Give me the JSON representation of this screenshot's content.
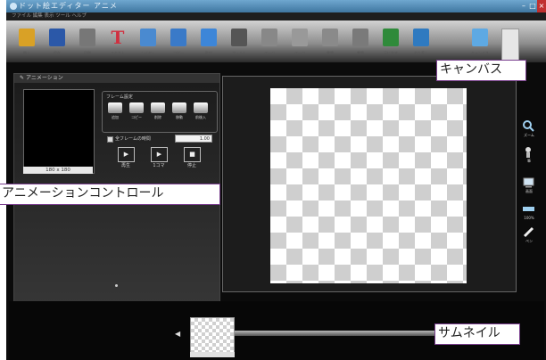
{
  "window": {
    "title": "ドット絵エディター  アニメ",
    "menu": "ファイル  編集  表示  ツール  ヘルプ"
  },
  "toolbar": {
    "tools": [
      {
        "name": "open-icon",
        "label": "開く",
        "color": "#d9a126"
      },
      {
        "name": "save-icon",
        "label": "保存",
        "color": "#2b58a8"
      },
      {
        "name": "print-icon",
        "label": "印刷",
        "color": "#777777"
      },
      {
        "name": "text-icon",
        "label": "テキスト",
        "color": "#d03040"
      },
      {
        "name": "layer-icon",
        "label": "レイヤー",
        "color": "#4a8ad0"
      },
      {
        "name": "copy-icon",
        "label": "コピー",
        "color": "#3a7ac8"
      },
      {
        "name": "paste-icon",
        "label": "貼付",
        "color": "#3d86d8"
      },
      {
        "name": "film-icon",
        "label": "フィルム",
        "color": "#555555"
      },
      {
        "name": "page-icon",
        "label": "ページ",
        "color": "#888888"
      },
      {
        "name": "page2-icon",
        "label": "ページ",
        "color": "#999999"
      },
      {
        "name": "doc-icon",
        "label": "書類",
        "color": "#8a8a8a"
      },
      {
        "name": "doc2-icon",
        "label": "書類",
        "color": "#7a7a7a"
      },
      {
        "name": "undo-icon",
        "label": "元に戻す",
        "color": "#2f8a3a"
      },
      {
        "name": "redo-icon",
        "label": "やり直し",
        "color": "#2f7ac0"
      },
      {
        "name": "canvas-icon",
        "label": "キャンバス",
        "color": "#5ea9e3"
      }
    ]
  },
  "animation_panel": {
    "header": "アニメーション",
    "preview_size": "180 x 180",
    "frame_settings_label": "フレーム設定",
    "frame_buttons": [
      "追加",
      "コピー",
      "削除",
      "移動",
      "前後入"
    ],
    "all_frame_label": "全フレームの時間",
    "all_frame_value": "1.00",
    "play_buttons": [
      {
        "symbol": "▶",
        "label": "再生"
      },
      {
        "symbol": "▶",
        "label": "1コマ"
      },
      {
        "symbol": "■",
        "label": "停止"
      }
    ]
  },
  "right_tools": [
    {
      "name": "zoom-icon",
      "label": "ズーム"
    },
    {
      "name": "brush-icon",
      "label": "筆"
    },
    {
      "name": "tv-icon",
      "label": "画面"
    },
    {
      "name": "ruler-icon",
      "label": "100%"
    },
    {
      "name": "pen-icon",
      "label": "ペン"
    }
  ],
  "callouts": {
    "canvas": "キャンバス",
    "animation_control": "アニメーションコントロール",
    "thumbnail": "サムネイル"
  }
}
